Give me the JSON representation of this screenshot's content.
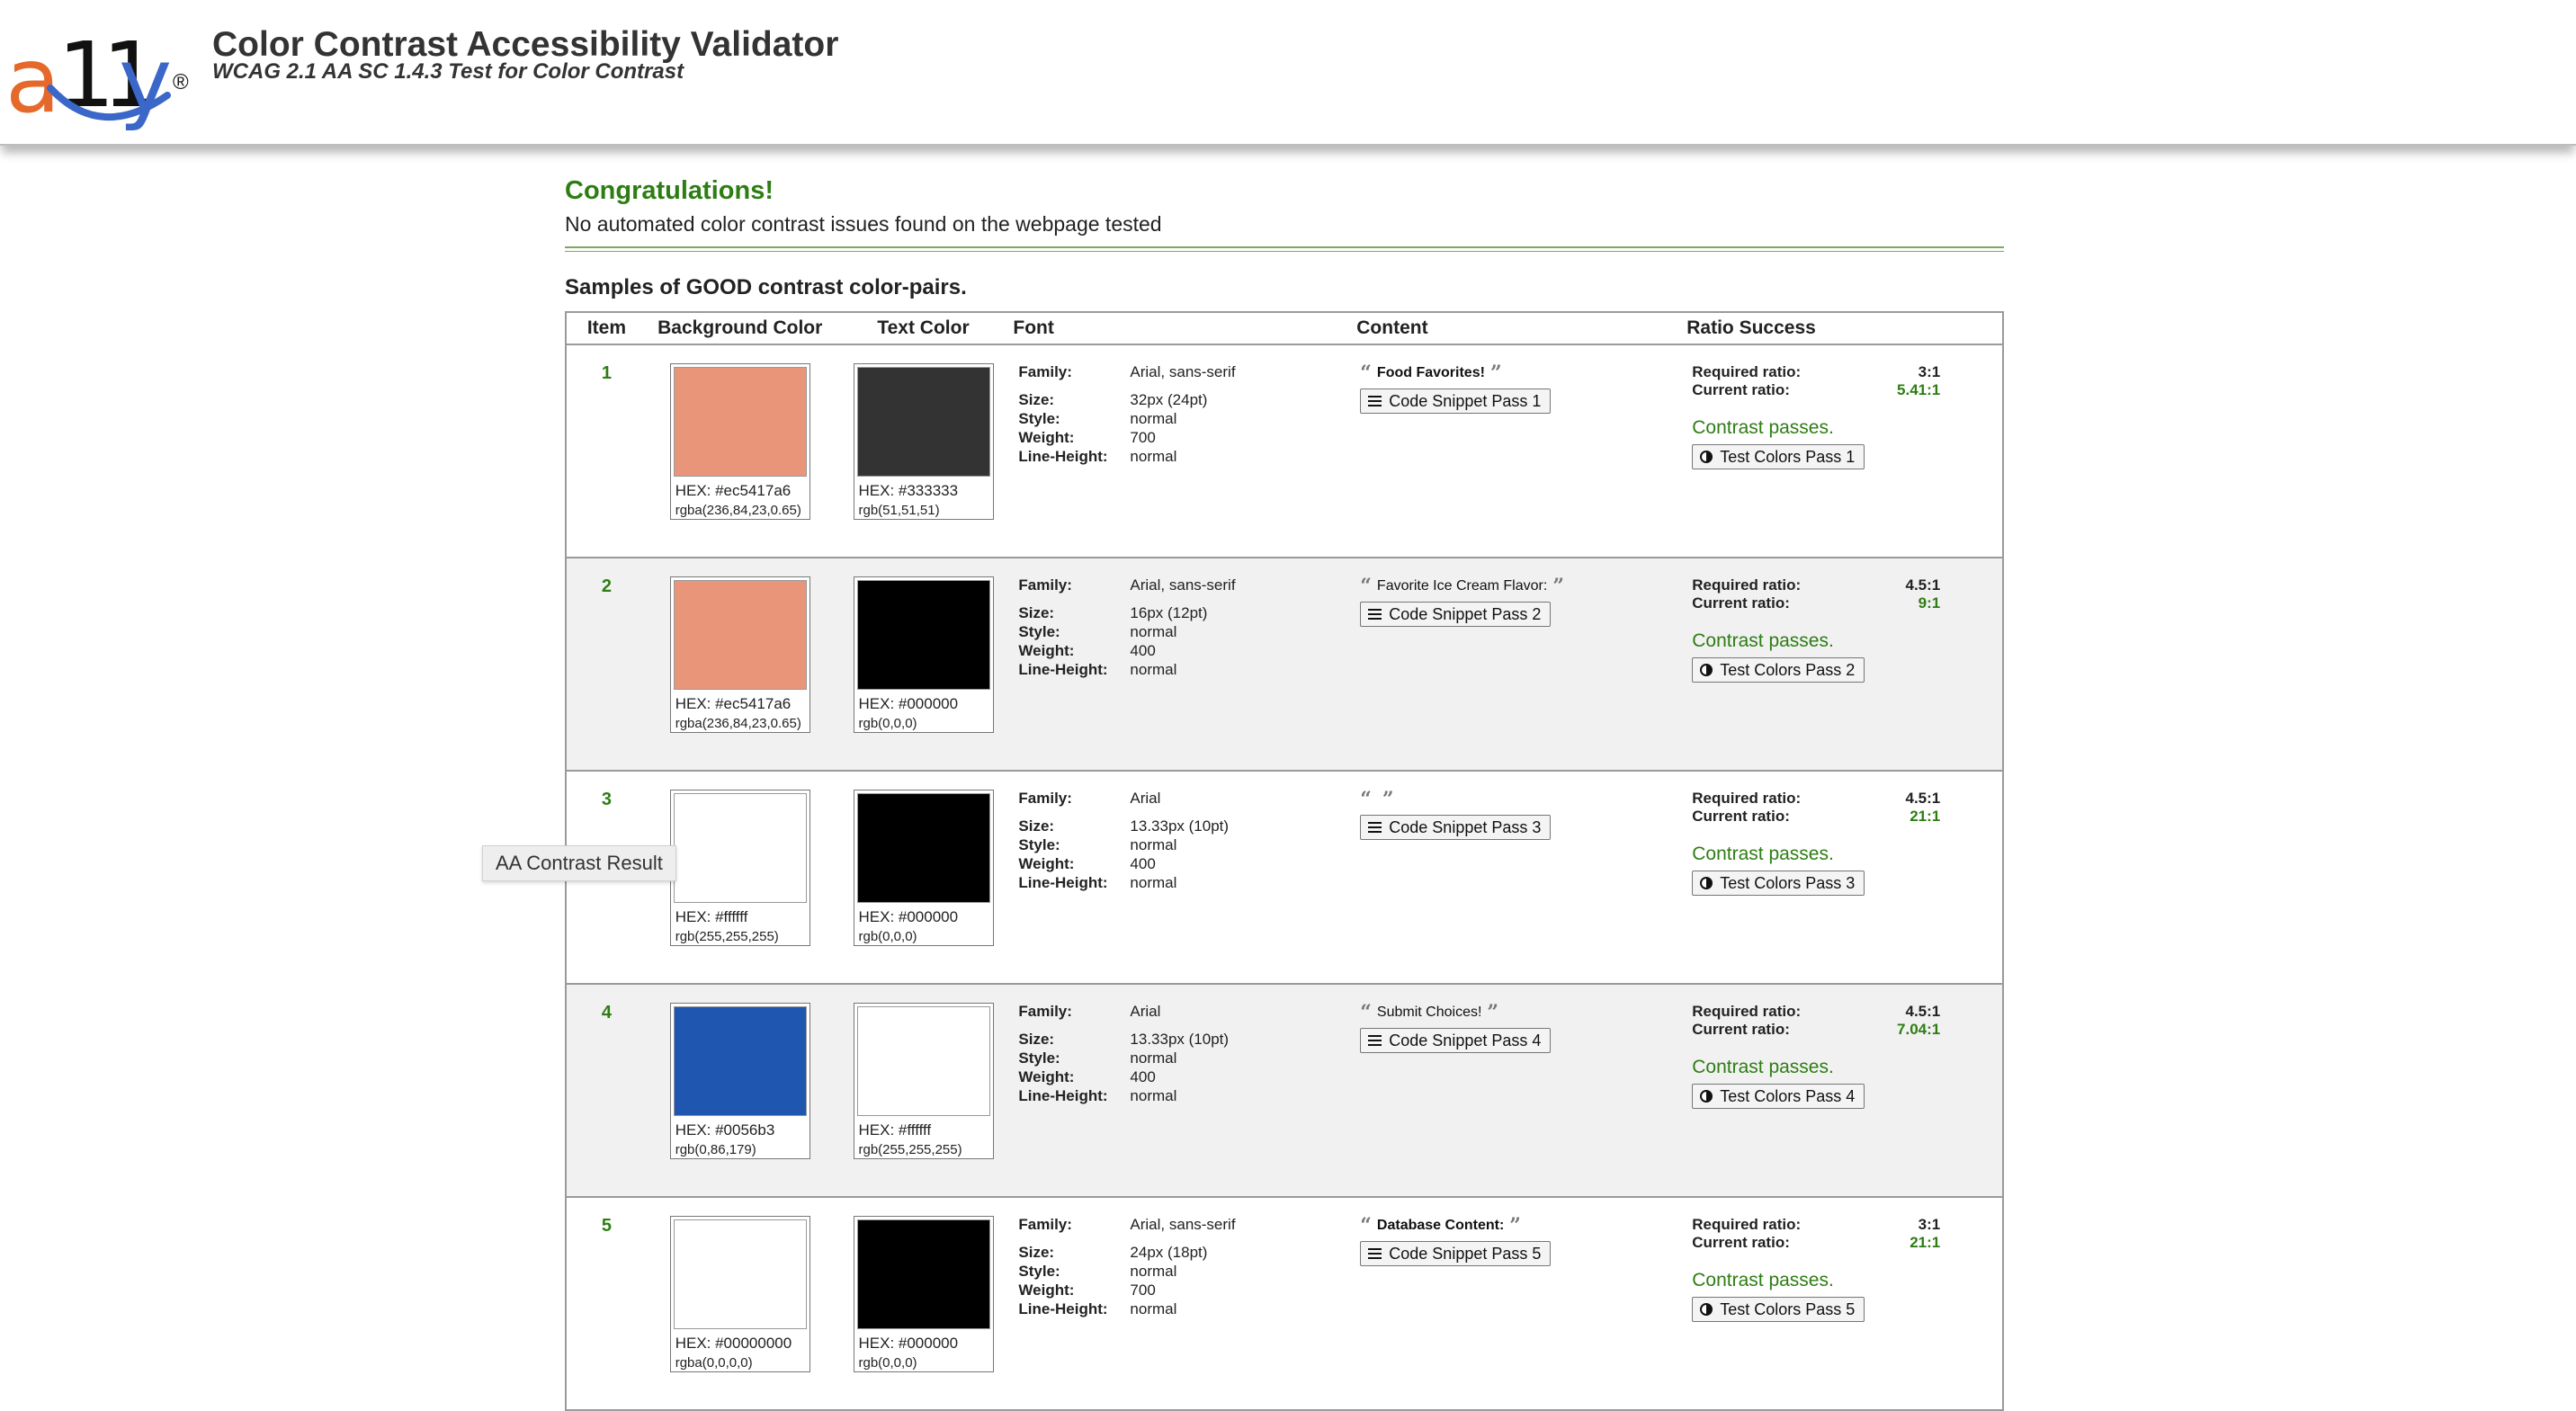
{
  "header": {
    "logo_a": "a",
    "logo_ones": "11",
    "logo_y": "y",
    "logo_reg": "®",
    "title": "Color Contrast Accessibility Validator",
    "subtitle": "WCAG 2.1 AA SC 1.4.3 Test for Color Contrast"
  },
  "result": {
    "heading": "Congratulations!",
    "message": "No automated color contrast issues found on the webpage tested"
  },
  "samples_heading": "Samples of GOOD contrast color-pairs.",
  "table": {
    "columns": [
      "Item",
      "Background Color",
      "Text Color",
      "Font",
      "Content",
      "Ratio Success"
    ],
    "labels": {
      "family": "Family:",
      "size": "Size:",
      "style": "Style:",
      "weight": "Weight:",
      "line_height": "Line-Height:",
      "required": "Required ratio:",
      "current": "Current ratio:",
      "pass": "Contrast passes."
    },
    "rows": [
      {
        "item": "1",
        "bg": {
          "color": "#e8957a",
          "hex": "HEX: #ec5417a6",
          "rgb": "rgba(236,84,23,0.65)"
        },
        "text": {
          "color": "#333333",
          "hex": "HEX: #333333",
          "rgb": "rgb(51,51,51)"
        },
        "font": {
          "family": "Arial, sans-serif",
          "size": "32px (24pt)",
          "style": "normal",
          "weight": "700",
          "line_height": "normal"
        },
        "content": "Food Favorites!",
        "content_bold": true,
        "snippet_button": "Code Snippet Pass 1",
        "required_ratio": "3:1",
        "current_ratio": "5.41:1",
        "test_button": "Test Colors Pass 1"
      },
      {
        "item": "2",
        "bg": {
          "color": "#e8957a",
          "hex": "HEX: #ec5417a6",
          "rgb": "rgba(236,84,23,0.65)"
        },
        "text": {
          "color": "#000000",
          "hex": "HEX: #000000",
          "rgb": "rgb(0,0,0)"
        },
        "font": {
          "family": "Arial, sans-serif",
          "size": "16px (12pt)",
          "style": "normal",
          "weight": "400",
          "line_height": "normal"
        },
        "content": "Favorite Ice Cream Flavor:",
        "content_bold": false,
        "snippet_button": "Code Snippet Pass 2",
        "required_ratio": "4.5:1",
        "current_ratio": "9:1",
        "test_button": "Test Colors Pass 2"
      },
      {
        "item": "3",
        "bg": {
          "color": "#ffffff",
          "hex": "HEX: #ffffff",
          "rgb": "rgb(255,255,255)"
        },
        "text": {
          "color": "#000000",
          "hex": "HEX: #000000",
          "rgb": "rgb(0,0,0)"
        },
        "font": {
          "family": "Arial",
          "size": "13.33px (10pt)",
          "style": "normal",
          "weight": "400",
          "line_height": "normal"
        },
        "content": "",
        "content_bold": false,
        "snippet_button": "Code Snippet Pass 3",
        "required_ratio": "4.5:1",
        "current_ratio": "21:1",
        "test_button": "Test Colors Pass 3"
      },
      {
        "item": "4",
        "bg": {
          "color": "#1f56b0",
          "hex": "HEX: #0056b3",
          "rgb": "rgb(0,86,179)"
        },
        "text": {
          "color": "#ffffff",
          "hex": "HEX: #ffffff",
          "rgb": "rgb(255,255,255)"
        },
        "font": {
          "family": "Arial",
          "size": "13.33px (10pt)",
          "style": "normal",
          "weight": "400",
          "line_height": "normal"
        },
        "content": "Submit Choices!",
        "content_bold": false,
        "snippet_button": "Code Snippet Pass 4",
        "required_ratio": "4.5:1",
        "current_ratio": "7.04:1",
        "test_button": "Test Colors Pass 4"
      },
      {
        "item": "5",
        "bg": {
          "color": "#ffffff",
          "hex": "HEX: #00000000",
          "rgb": "rgba(0,0,0,0)"
        },
        "text": {
          "color": "#000000",
          "hex": "HEX: #000000",
          "rgb": "rgb(0,0,0)"
        },
        "font": {
          "family": "Arial, sans-serif",
          "size": "24px (18pt)",
          "style": "normal",
          "weight": "700",
          "line_height": "normal"
        },
        "content": "Database Content:",
        "content_bold": true,
        "snippet_button": "Code Snippet Pass 5",
        "required_ratio": "3:1",
        "current_ratio": "21:1",
        "test_button": "Test Colors Pass 5"
      }
    ]
  },
  "tooltip": "AA Contrast Result"
}
